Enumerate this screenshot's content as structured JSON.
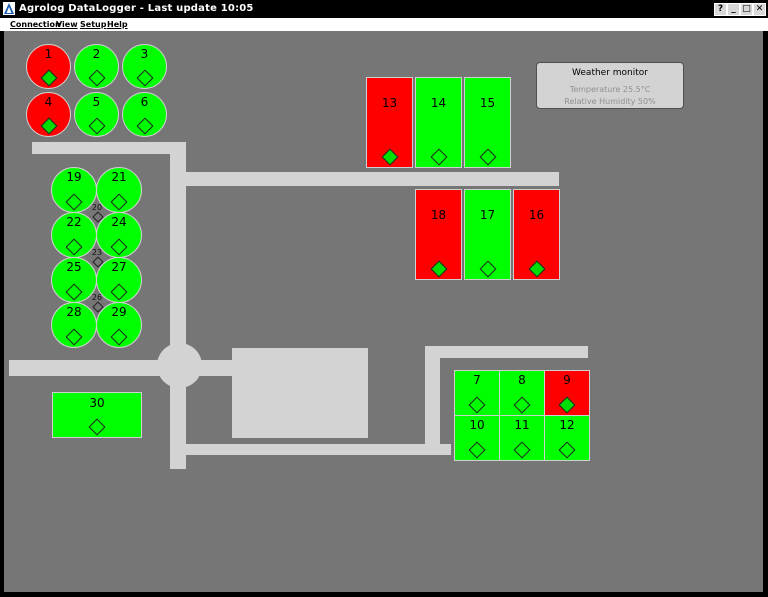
{
  "window": {
    "title": "Agrolog DataLogger - Last update 10:05",
    "buttons": {
      "help": "?",
      "minimize": "_",
      "maximize": "□",
      "close": "✕"
    }
  },
  "menu": [
    "Connection",
    "View",
    "Setup",
    "Help"
  ],
  "colors": {
    "alarm": "#ff0000",
    "ok": "#00ff00",
    "indicator_on": "#00dd00",
    "road": "#d3d3d3",
    "background": "#767676"
  },
  "weather": {
    "title": "Weather monitor",
    "temperature": "Temperature 25.5°C",
    "humidity": "Relative Humidity 50%"
  },
  "silos": [
    {
      "id": "1",
      "status": "alarm",
      "indicator": "on"
    },
    {
      "id": "2",
      "status": "ok",
      "indicator": "off"
    },
    {
      "id": "3",
      "status": "ok",
      "indicator": "off"
    },
    {
      "id": "4",
      "status": "alarm",
      "indicator": "on"
    },
    {
      "id": "5",
      "status": "ok",
      "indicator": "off"
    },
    {
      "id": "6",
      "status": "ok",
      "indicator": "off"
    },
    {
      "id": "13",
      "status": "alarm",
      "indicator": "on"
    },
    {
      "id": "14",
      "status": "ok",
      "indicator": "off"
    },
    {
      "id": "15",
      "status": "ok",
      "indicator": "off"
    },
    {
      "id": "18",
      "status": "alarm",
      "indicator": "on"
    },
    {
      "id": "17",
      "status": "ok",
      "indicator": "off"
    },
    {
      "id": "16",
      "status": "alarm",
      "indicator": "on"
    },
    {
      "id": "19",
      "status": "ok",
      "indicator": "off"
    },
    {
      "id": "21",
      "status": "ok",
      "indicator": "off"
    },
    {
      "id": "22",
      "status": "ok",
      "indicator": "off"
    },
    {
      "id": "24",
      "status": "ok",
      "indicator": "off"
    },
    {
      "id": "25",
      "status": "ok",
      "indicator": "off"
    },
    {
      "id": "27",
      "status": "ok",
      "indicator": "off"
    },
    {
      "id": "28",
      "status": "ok",
      "indicator": "off"
    },
    {
      "id": "29",
      "status": "ok",
      "indicator": "off"
    },
    {
      "id": "30",
      "status": "ok",
      "indicator": "off"
    },
    {
      "id": "7",
      "status": "ok",
      "indicator": "off"
    },
    {
      "id": "8",
      "status": "ok",
      "indicator": "off"
    },
    {
      "id": "9",
      "status": "alarm",
      "indicator": "on"
    },
    {
      "id": "10",
      "status": "ok",
      "indicator": "off"
    },
    {
      "id": "11",
      "status": "ok",
      "indicator": "off"
    },
    {
      "id": "12",
      "status": "ok",
      "indicator": "off"
    }
  ],
  "mini_silos": [
    {
      "id": "20"
    },
    {
      "id": "23"
    },
    {
      "id": "26"
    }
  ]
}
